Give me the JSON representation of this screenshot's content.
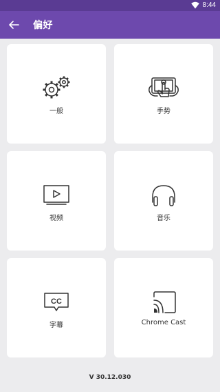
{
  "status_bar": {
    "time": "8:44",
    "wifi_icon": "wifi-icon"
  },
  "app_bar": {
    "back_icon": "arrow-back-icon",
    "title": "偏好"
  },
  "cards": [
    {
      "label": "一般",
      "icon": "gears-icon"
    },
    {
      "label": "手势",
      "icon": "gesture-tablet-icon"
    },
    {
      "label": "视频",
      "icon": "video-play-icon"
    },
    {
      "label": "音乐",
      "icon": "headphones-icon"
    },
    {
      "label": "字幕",
      "icon": "subtitles-cc-icon"
    },
    {
      "label": "Chrome Cast",
      "icon": "chromecast-icon"
    }
  ],
  "version": "V 30.12.030",
  "colors": {
    "status_bar": "#5a3b93",
    "app_bar": "#6d49ad",
    "background": "#ececee",
    "card": "#ffffff"
  }
}
